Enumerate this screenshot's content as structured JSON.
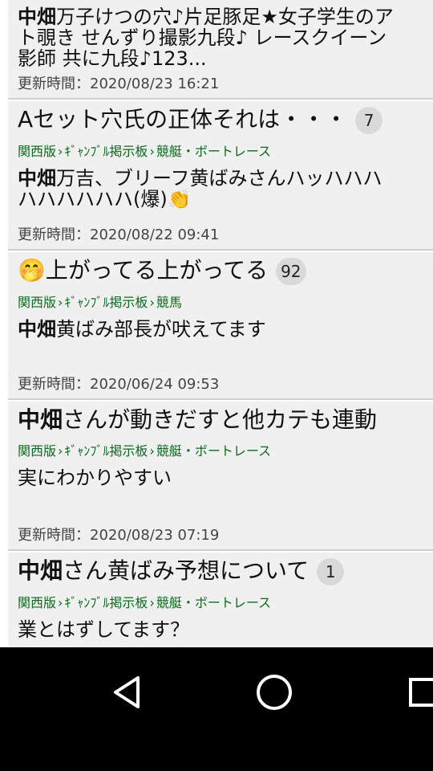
{
  "results": [
    {
      "snippet_bold": "中畑",
      "snippet": "万子けつの穴♪片足豚足★女子学生のア\nト覗き せんずり撮影九段♪ レースクイーン\n影師 共に九段♪123...",
      "updated_label": "更新時間：",
      "updated": "2020/08/23 16:21"
    },
    {
      "title": "Aセット穴氏の正体それは・・・",
      "count": "7",
      "crumbs": [
        "関西版",
        "ｷﾞｬﾝﾌﾞﾙ掲示板",
        "競艇・ボートレース"
      ],
      "snippet_bold": "中畑",
      "snippet": "万吉、ブリーフ黄ばみさんハッハハハ\nハハハハハハ(爆)👏",
      "updated_label": "更新時間：",
      "updated": "2020/08/22 09:41"
    },
    {
      "title_emoji": "🤭",
      "title": "上がってる上がってる",
      "count": "92",
      "crumbs": [
        "関西版",
        "ｷﾞｬﾝﾌﾞﾙ掲示板",
        "競馬"
      ],
      "snippet_bold": "中畑",
      "snippet": "黄ばみ部長が吠えてます",
      "updated_label": "更新時間：",
      "updated": "2020/06/24 09:53"
    },
    {
      "title_bold": "中畑",
      "title": "さんが動きだすと他カテも連動",
      "crumbs": [
        "関西版",
        "ｷﾞｬﾝﾌﾞﾙ掲示板",
        "競艇・ボートレース"
      ],
      "snippet": "実にわかりやすい",
      "updated_label": "更新時間：",
      "updated": "2020/08/23 07:19"
    },
    {
      "title_bold": "中畑",
      "title": "さん黄ばみ予想について",
      "count": "1",
      "crumbs": [
        "関西版",
        "ｷﾞｬﾝﾌﾞﾙ掲示板",
        "競艇・ボートレース"
      ],
      "snippet": "業とはずしてます？"
    }
  ],
  "navbar": {
    "back_icon": "back-triangle-icon",
    "home_icon": "home-circle-icon",
    "recents_icon": "recents-square-icon"
  },
  "colors": {
    "card_bg": "#f0f0f0",
    "crumb_green": "#0a6b1a",
    "badge_bg": "#d9d9d9"
  }
}
